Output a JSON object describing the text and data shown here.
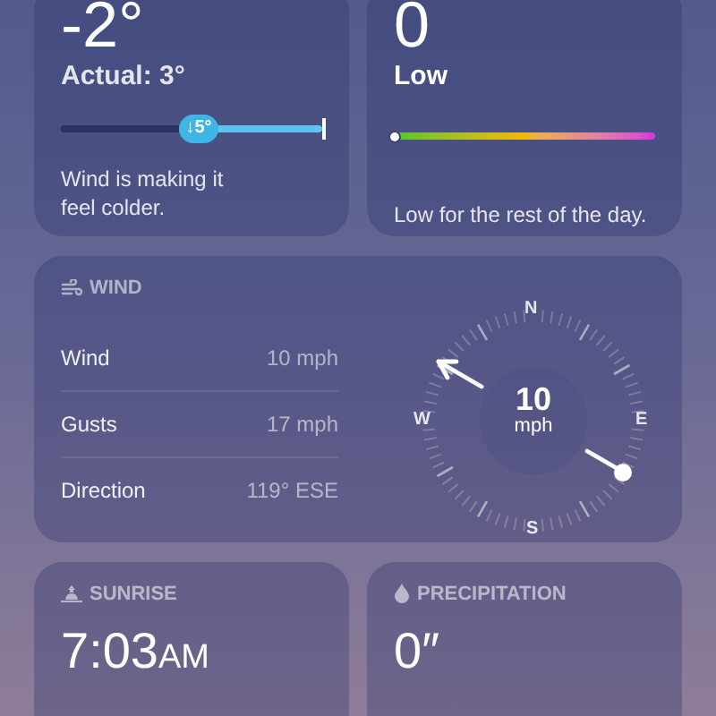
{
  "feels_like": {
    "value": "-2°",
    "actual": "Actual: 3°",
    "badge": "↓5°",
    "note": "Wind is making it feel colder."
  },
  "uv_index": {
    "value": "0",
    "label": "Low",
    "level": 0,
    "note": "Low for the rest of the day."
  },
  "wind": {
    "title": "WIND",
    "rows": [
      {
        "label": "Wind",
        "value": "10 mph"
      },
      {
        "label": "Gusts",
        "value": "17 mph"
      },
      {
        "label": "Direction",
        "value": "119° ESE"
      }
    ],
    "compass": {
      "speed": "10",
      "unit": "mph",
      "north": "N",
      "east": "E",
      "south": "S",
      "west": "W"
    }
  },
  "sunrise": {
    "title": "SUNRISE",
    "time": "7:03",
    "suffix": "AM"
  },
  "precipitation": {
    "title": "PRECIPITATION",
    "value": "0″"
  }
}
